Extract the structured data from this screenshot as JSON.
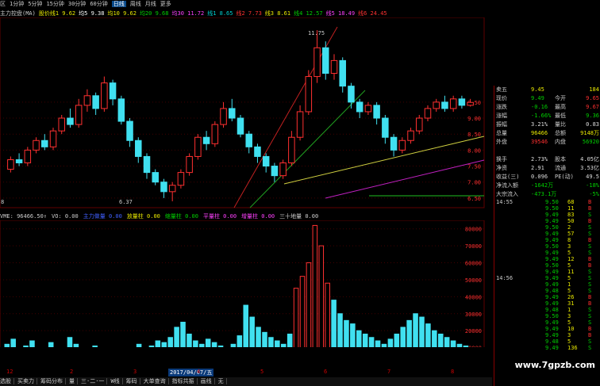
{
  "topbar": {
    "items": [
      "区",
      "1分钟",
      "5分钟",
      "15分钟",
      "30分钟",
      "60分钟",
      "日线",
      "周线",
      "月线",
      "更多"
    ],
    "active_index": 6,
    "mode_tag": "日线"
  },
  "indicator_bar": {
    "items": [
      {
        "text": "主力控盘(MA)",
        "color": "#cccccc"
      },
      {
        "text": "股价线1 9.62",
        "color": "#e8e800"
      },
      {
        "text": "均5 9.38",
        "color": "#ffffff"
      },
      {
        "text": "均10 9.62",
        "color": "#e8e800"
      },
      {
        "text": "均20 9.68",
        "color": "#00d000"
      },
      {
        "text": "均30 11.72",
        "color": "#ff40ff"
      },
      {
        "text": "线1 8.65",
        "color": "#00d0d0"
      },
      {
        "text": "线2 7.73",
        "color": "#ff3030"
      },
      {
        "text": "线3 8.61",
        "color": "#e8e800"
      },
      {
        "text": "线4 12.57",
        "color": "#00d000"
      },
      {
        "text": "线5 18.49",
        "color": "#ff40ff"
      },
      {
        "text": "线6 24.45",
        "color": "#ff3030"
      }
    ]
  },
  "kchart": {
    "high_label": "11.75",
    "low_label": "6.37",
    "left_label": "8",
    "price_ticks": [
      "9.50",
      "9.00",
      "8.50",
      "8.00",
      "7.50",
      "7.00",
      "6.50"
    ],
    "candles": [
      {
        "o": 7.4,
        "c": 7.7,
        "h": 7.8,
        "l": 7.3
      },
      {
        "o": 7.7,
        "c": 7.6,
        "h": 7.9,
        "l": 7.5
      },
      {
        "o": 7.6,
        "c": 8.0,
        "h": 8.1,
        "l": 7.5
      },
      {
        "o": 8.0,
        "c": 8.3,
        "h": 8.4,
        "l": 7.9
      },
      {
        "o": 8.3,
        "c": 8.1,
        "h": 8.5,
        "l": 8.0
      },
      {
        "o": 8.1,
        "c": 8.6,
        "h": 8.7,
        "l": 8.0
      },
      {
        "o": 8.6,
        "c": 9.0,
        "h": 9.1,
        "l": 8.5
      },
      {
        "o": 9.0,
        "c": 8.8,
        "h": 9.3,
        "l": 8.7
      },
      {
        "o": 8.8,
        "c": 9.4,
        "h": 9.6,
        "l": 8.7
      },
      {
        "o": 9.4,
        "c": 9.7,
        "h": 9.9,
        "l": 9.2
      },
      {
        "o": 9.7,
        "c": 9.3,
        "h": 9.8,
        "l": 9.1
      },
      {
        "o": 9.3,
        "c": 10.1,
        "h": 10.3,
        "l": 9.2
      },
      {
        "o": 10.1,
        "c": 9.6,
        "h": 10.2,
        "l": 9.4
      },
      {
        "o": 9.6,
        "c": 8.9,
        "h": 9.7,
        "l": 8.8
      },
      {
        "o": 8.9,
        "c": 8.3,
        "h": 9.0,
        "l": 8.1
      },
      {
        "o": 8.3,
        "c": 7.8,
        "h": 8.4,
        "l": 7.6
      },
      {
        "o": 7.8,
        "c": 7.3,
        "h": 7.9,
        "l": 7.1
      },
      {
        "o": 7.3,
        "c": 7.0,
        "h": 7.4,
        "l": 6.9
      },
      {
        "o": 7.0,
        "c": 6.7,
        "h": 7.1,
        "l": 6.5
      },
      {
        "o": 6.7,
        "c": 6.9,
        "h": 7.0,
        "l": 6.4
      },
      {
        "o": 6.9,
        "c": 7.3,
        "h": 7.4,
        "l": 6.8
      },
      {
        "o": 7.3,
        "c": 7.8,
        "h": 7.9,
        "l": 7.2
      },
      {
        "o": 7.8,
        "c": 8.4,
        "h": 8.5,
        "l": 7.7
      },
      {
        "o": 8.4,
        "c": 8.2,
        "h": 8.6,
        "l": 8.0
      },
      {
        "o": 8.2,
        "c": 8.8,
        "h": 8.9,
        "l": 8.1
      },
      {
        "o": 8.8,
        "c": 9.3,
        "h": 9.5,
        "l": 8.7
      },
      {
        "o": 9.3,
        "c": 9.0,
        "h": 9.6,
        "l": 8.9
      },
      {
        "o": 9.0,
        "c": 8.5,
        "h": 9.1,
        "l": 8.4
      },
      {
        "o": 8.5,
        "c": 8.1,
        "h": 8.6,
        "l": 7.9
      },
      {
        "o": 8.1,
        "c": 7.8,
        "h": 8.2,
        "l": 7.6
      },
      {
        "o": 7.8,
        "c": 7.5,
        "h": 7.9,
        "l": 7.3
      },
      {
        "o": 7.5,
        "c": 7.2,
        "h": 7.6,
        "l": 7.0
      },
      {
        "o": 7.2,
        "c": 7.6,
        "h": 7.7,
        "l": 7.1
      },
      {
        "o": 7.6,
        "c": 8.4,
        "h": 8.6,
        "l": 7.5
      },
      {
        "o": 8.4,
        "c": 9.2,
        "h": 9.4,
        "l": 8.3
      },
      {
        "o": 9.2,
        "c": 10.3,
        "h": 10.5,
        "l": 9.1
      },
      {
        "o": 10.3,
        "c": 11.2,
        "h": 11.75,
        "l": 10.1
      },
      {
        "o": 11.2,
        "c": 10.4,
        "h": 11.4,
        "l": 10.2
      },
      {
        "o": 10.4,
        "c": 10.8,
        "h": 11.0,
        "l": 10.2
      },
      {
        "o": 10.8,
        "c": 10.0,
        "h": 10.9,
        "l": 9.8
      },
      {
        "o": 10.0,
        "c": 9.5,
        "h": 10.1,
        "l": 9.3
      },
      {
        "o": 9.5,
        "c": 9.2,
        "h": 9.6,
        "l": 9.0
      },
      {
        "o": 9.2,
        "c": 9.4,
        "h": 9.5,
        "l": 9.1
      },
      {
        "o": 9.4,
        "c": 9.0,
        "h": 9.5,
        "l": 8.8
      },
      {
        "o": 9.0,
        "c": 8.4,
        "h": 9.1,
        "l": 8.2
      },
      {
        "o": 8.4,
        "c": 8.0,
        "h": 8.5,
        "l": 7.8
      },
      {
        "o": 8.0,
        "c": 8.3,
        "h": 8.4,
        "l": 7.9
      },
      {
        "o": 8.3,
        "c": 8.6,
        "h": 8.7,
        "l": 8.2
      },
      {
        "o": 8.6,
        "c": 9.0,
        "h": 9.1,
        "l": 8.5
      },
      {
        "o": 9.0,
        "c": 9.3,
        "h": 9.4,
        "l": 8.9
      },
      {
        "o": 9.3,
        "c": 9.5,
        "h": 9.6,
        "l": 9.2
      },
      {
        "o": 9.5,
        "c": 9.3,
        "h": 9.7,
        "l": 9.2
      },
      {
        "o": 9.3,
        "c": 9.6,
        "h": 9.7,
        "l": 9.2
      },
      {
        "o": 9.6,
        "c": 9.4,
        "h": 9.7,
        "l": 9.3
      },
      {
        "o": 9.4,
        "c": 9.49,
        "h": 9.6,
        "l": 9.36
      }
    ]
  },
  "volume_bar": {
    "items": [
      {
        "text": "VME: 96466.50↑",
        "color": "#cccccc"
      },
      {
        "text": "VO: 0.00",
        "color": "#cccccc"
      },
      {
        "text": "主力做量 0.00",
        "color": "#4060ff"
      },
      {
        "text": "放量柱 0.00",
        "color": "#e8e800"
      },
      {
        "text": "缩量柱 0.00",
        "color": "#00d000"
      },
      {
        "text": "平量柱 0.00",
        "color": "#ff40ff"
      },
      {
        "text": "增量柱 0.00",
        "color": "#ff40ff"
      },
      {
        "text": "三十地量 0.00",
        "color": "#cccccc"
      }
    ],
    "ticks": [
      "80000",
      "70000",
      "60000",
      "50000",
      "40000",
      "30000",
      "20000",
      "10000"
    ],
    "max": 85000,
    "values": [
      12000,
      15000,
      9000,
      11000,
      14000,
      10000,
      8000,
      13000,
      9000,
      7000,
      16000,
      12000,
      10000,
      9000,
      11000,
      8000,
      7000,
      6000,
      9000,
      8000,
      10000,
      12000,
      9000,
      11000,
      14000,
      13000,
      16000,
      22000,
      25000,
      18000,
      14000,
      12000,
      15000,
      13000,
      11000,
      9000,
      12000,
      17000,
      35000,
      28000,
      22000,
      19000,
      16000,
      14000,
      12000,
      18000,
      45000,
      52000,
      60000,
      82000,
      70000,
      48000,
      38000,
      30000,
      26000,
      24000,
      20000,
      18000,
      16000,
      14000,
      12000,
      15000,
      18000,
      22000,
      26000,
      30000,
      28000,
      24000,
      20000,
      18000,
      16000,
      14000,
      12000,
      11000,
      10000
    ]
  },
  "xaxis": {
    "date_label": "2017/04/07/五",
    "marks": [
      "12",
      "2",
      "3",
      "4",
      "5",
      "6",
      "7",
      "8"
    ]
  },
  "quote": {
    "rows": [
      {
        "l1": "卖五",
        "v1": "9.45",
        "l2": "",
        "v2": "184",
        "c1": "#e8e800",
        "c2": "#e8e800"
      },
      {
        "l1": "现价",
        "v1": "9.49",
        "l2": "今开",
        "v2": "9.65",
        "c1": "#00d000",
        "c2": "#ff3030"
      },
      {
        "l1": "涨跌",
        "v1": "-0.16",
        "l2": "最高",
        "v2": "9.67",
        "c1": "#00d000",
        "c2": "#ff3030"
      },
      {
        "l1": "涨幅",
        "v1": "-1.66%",
        "l2": "最低",
        "v2": "9.36",
        "c1": "#00d000",
        "c2": "#00d000"
      },
      {
        "l1": "振幅",
        "v1": "3.21%",
        "l2": "量比",
        "v2": "0.83",
        "c1": "#dddddd",
        "c2": "#dddddd"
      },
      {
        "l1": "总量",
        "v1": "96466",
        "l2": "总额",
        "v2": "9148万",
        "c1": "#e8e800",
        "c2": "#e8e800"
      },
      {
        "l1": "外盘",
        "v1": "39546",
        "l2": "内盘",
        "v2": "56920",
        "c1": "#ff3030",
        "c2": "#00d000"
      },
      {
        "l1": "",
        "v1": "",
        "l2": "",
        "v2": "",
        "c1": "#dddddd",
        "c2": "#dddddd"
      },
      {
        "l1": "换手",
        "v1": "2.73%",
        "l2": "股本",
        "v2": "4.05亿",
        "c1": "#dddddd",
        "c2": "#dddddd"
      },
      {
        "l1": "净资",
        "v1": "2.91",
        "l2": "流通",
        "v2": "3.53亿",
        "c1": "#dddddd",
        "c2": "#dddddd"
      },
      {
        "l1": "收益(三)",
        "v1": "0.096",
        "l2": "PE(动)",
        "v2": "49.5",
        "c1": "#dddddd",
        "c2": "#dddddd"
      },
      {
        "l1": "净流入额",
        "v1": "-1642万",
        "l2": "",
        "v2": "-18%",
        "c1": "#00d000",
        "c2": "#00d000"
      },
      {
        "l1": "大宗流入",
        "v1": "-473.1万",
        "l2": "",
        "v2": "-5%",
        "c1": "#00d000",
        "c2": "#00d000"
      }
    ],
    "ticks": [
      {
        "t": "14:55",
        "p": "9.50",
        "q": "68",
        "d": "B"
      },
      {
        "t": "",
        "p": "9.50",
        "q": "11",
        "d": "B"
      },
      {
        "t": "",
        "p": "9.49",
        "q": "83",
        "d": "S"
      },
      {
        "t": "",
        "p": "9.49",
        "q": "50",
        "d": "B"
      },
      {
        "t": "",
        "p": "9.50",
        "q": "2",
        "d": "S"
      },
      {
        "t": "",
        "p": "9.49",
        "q": "57",
        "d": "S"
      },
      {
        "t": "",
        "p": "9.49",
        "q": "8",
        "d": "B"
      },
      {
        "t": "",
        "p": "9.50",
        "q": "3",
        "d": "S"
      },
      {
        "t": "",
        "p": "9.49",
        "q": "5",
        "d": "S"
      },
      {
        "t": "",
        "p": "9.49",
        "q": "12",
        "d": "B"
      },
      {
        "t": "",
        "p": "9.50",
        "q": "5",
        "d": "B"
      },
      {
        "t": "",
        "p": "9.49",
        "q": "11",
        "d": "S"
      },
      {
        "t": "14:56",
        "p": "9.49",
        "q": "5",
        "d": "S"
      },
      {
        "t": "",
        "p": "9.49",
        "q": "1",
        "d": "S"
      },
      {
        "t": "",
        "p": "9.48",
        "q": "5",
        "d": "S"
      },
      {
        "t": "",
        "p": "9.49",
        "q": "26",
        "d": "B"
      },
      {
        "t": "",
        "p": "9.49",
        "q": "31",
        "d": "B"
      },
      {
        "t": "",
        "p": "9.48",
        "q": "1",
        "d": "S"
      },
      {
        "t": "",
        "p": "9.50",
        "q": "3",
        "d": "S"
      },
      {
        "t": "",
        "p": "9.49",
        "q": "5",
        "d": "S"
      },
      {
        "t": "",
        "p": "9.49",
        "q": "10",
        "d": "B"
      },
      {
        "t": "",
        "p": "9.49",
        "q": "3",
        "d": "B"
      },
      {
        "t": "",
        "p": "9.48",
        "q": "5",
        "d": "S"
      },
      {
        "t": "",
        "p": "9.49",
        "q": "136",
        "d": "S"
      }
    ]
  },
  "statusbar": {
    "items": [
      "选股",
      "买卖力",
      "筹码分布",
      "量",
      "三·二·一",
      "W线",
      "筹码",
      "大单查询",
      "指标共振",
      "画线",
      "无"
    ]
  },
  "watermark": "www.7gpzb.com",
  "colors": {
    "up": "#ff3030",
    "down": "#40e0f0",
    "grid": "#600000"
  }
}
